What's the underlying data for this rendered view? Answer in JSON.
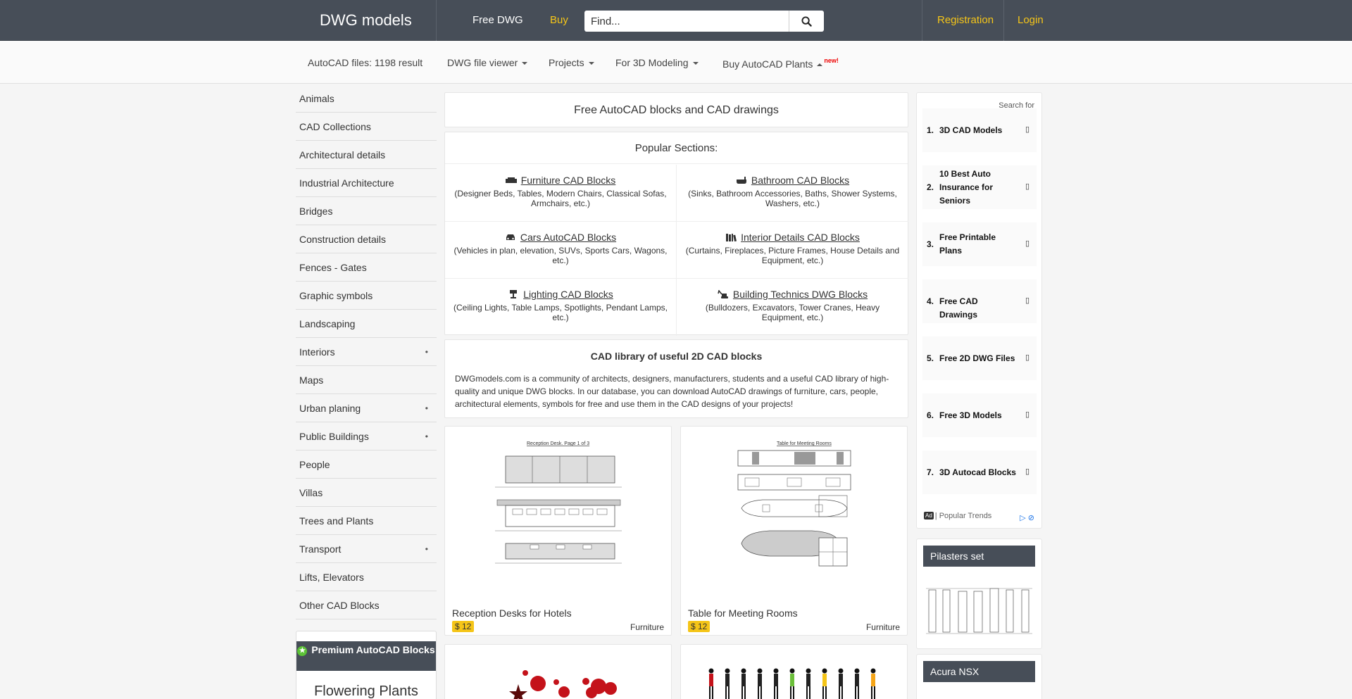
{
  "header": {
    "brand": "DWG models",
    "nav_free": "Free DWG",
    "nav_buy": "Buy",
    "search_placeholder": "Find...",
    "registration": "Registration",
    "login": "Login",
    "accent_color": "#f5c518",
    "bar_color": "#474e58"
  },
  "subnav": {
    "autocad_files": "AutoCAD files: 1198 result",
    "viewer": "DWG file viewer",
    "projects": "Projects",
    "modeling": "For 3D Modeling",
    "buy_plants": "Buy AutoCAD Plants",
    "new_badge": "new!"
  },
  "sidebar": {
    "items": [
      {
        "label": "Animals",
        "dot": ""
      },
      {
        "label": "CAD Collections",
        "dot": ""
      },
      {
        "label": "Architectural details",
        "dot": ""
      },
      {
        "label": "Industrial Architecture",
        "dot": ""
      },
      {
        "label": "Bridges",
        "dot": ""
      },
      {
        "label": "Construction details",
        "dot": ""
      },
      {
        "label": "Fences - Gates",
        "dot": ""
      },
      {
        "label": "Graphic symbols",
        "dot": ""
      },
      {
        "label": "Landscaping",
        "dot": ""
      },
      {
        "label": "Interiors",
        "dot": "•"
      },
      {
        "label": "Maps",
        "dot": ""
      },
      {
        "label": "Urban planing",
        "dot": "•"
      },
      {
        "label": "Public Buildings",
        "dot": "•"
      },
      {
        "label": "People",
        "dot": ""
      },
      {
        "label": "Villas",
        "dot": ""
      },
      {
        "label": "Trees and Plants",
        "dot": ""
      },
      {
        "label": "Transport",
        "dot": "•"
      },
      {
        "label": "Lifts, Elevators",
        "dot": ""
      },
      {
        "label": "Other CAD Blocks",
        "dot": ""
      }
    ],
    "premium_title": "Premium AutoCAD Blocks",
    "premium_sub": "Flowering Plants"
  },
  "main": {
    "title": "Free AutoCAD blocks and CAD drawings",
    "popular_title": "Popular Sections:",
    "popular": [
      {
        "icon": "sofa-icon",
        "label": "Furniture CAD Blocks",
        "desc": "(Designer Beds, Tables, Modern Chairs, Classical Sofas, Armchairs, etc.)"
      },
      {
        "icon": "bathtub-icon",
        "label": "Bathroom CAD Blocks",
        "desc": "(Sinks, Bathroom Accessories, Baths, Shower Systems, Washers, etc.)"
      },
      {
        "icon": "car-icon",
        "label": "Cars AutoCAD Blocks",
        "desc": "(Vehicles in plan, elevation, SUVs, Sports Cars, Wagons, etc.)"
      },
      {
        "icon": "books-icon",
        "label": "Interior Details CAD Blocks",
        "desc": "(Curtains, Fireplaces, Picture Frames, House Details and Equipment, etc.)"
      },
      {
        "icon": "lamp-icon",
        "label": "Lighting CAD Blocks",
        "desc": "(Ceiling Lights, Table Lamps, Spotlights, Pendant Lamps, etc.)"
      },
      {
        "icon": "excavator-icon",
        "label": "Building Technics DWG Blocks",
        "desc": "(Bulldozers, Excavators, Tower Cranes, Heavy Equipment, etc.)"
      }
    ],
    "library_title": "CAD library of useful 2D CAD blocks",
    "library_text": "DWGmodels.com is a community of architects, designers, manufacturers, students and a useful CAD library of high-quality and unique DWG blocks. In our database, you can download AutoCAD drawings of furniture, cars, people, architectural elements, symbols for free and use them in the CAD designs of your projects!",
    "cards": [
      {
        "title": "Reception Desks for Hotels",
        "price": "$ 12",
        "category": "Furniture",
        "thumb_caption": "Reception Desk. Page 1 of 3"
      },
      {
        "title": "Table for Meeting Rooms",
        "price": "$ 12",
        "category": "Furniture",
        "thumb_caption": "Table for Meeting Rooms"
      }
    ]
  },
  "ad": {
    "search_for": "Search for",
    "items": [
      {
        "num": "1.",
        "text": "3D CAD Models"
      },
      {
        "num": "2.",
        "text": "10 Best Auto Insurance for Seniors"
      },
      {
        "num": "3.",
        "text": "Free Printable Plans"
      },
      {
        "num": "4.",
        "text": "Free CAD Drawings"
      },
      {
        "num": "5.",
        "text": "Free 2D DWG Files"
      },
      {
        "num": "6.",
        "text": "Free 3D Models"
      },
      {
        "num": "7.",
        "text": "3D Autocad Blocks"
      }
    ],
    "arrow": "▯",
    "badge": "Ad",
    "footer": "| Popular Trends"
  },
  "right_cards": [
    {
      "title": "Pilasters set"
    },
    {
      "title": "Acura NSX"
    }
  ]
}
